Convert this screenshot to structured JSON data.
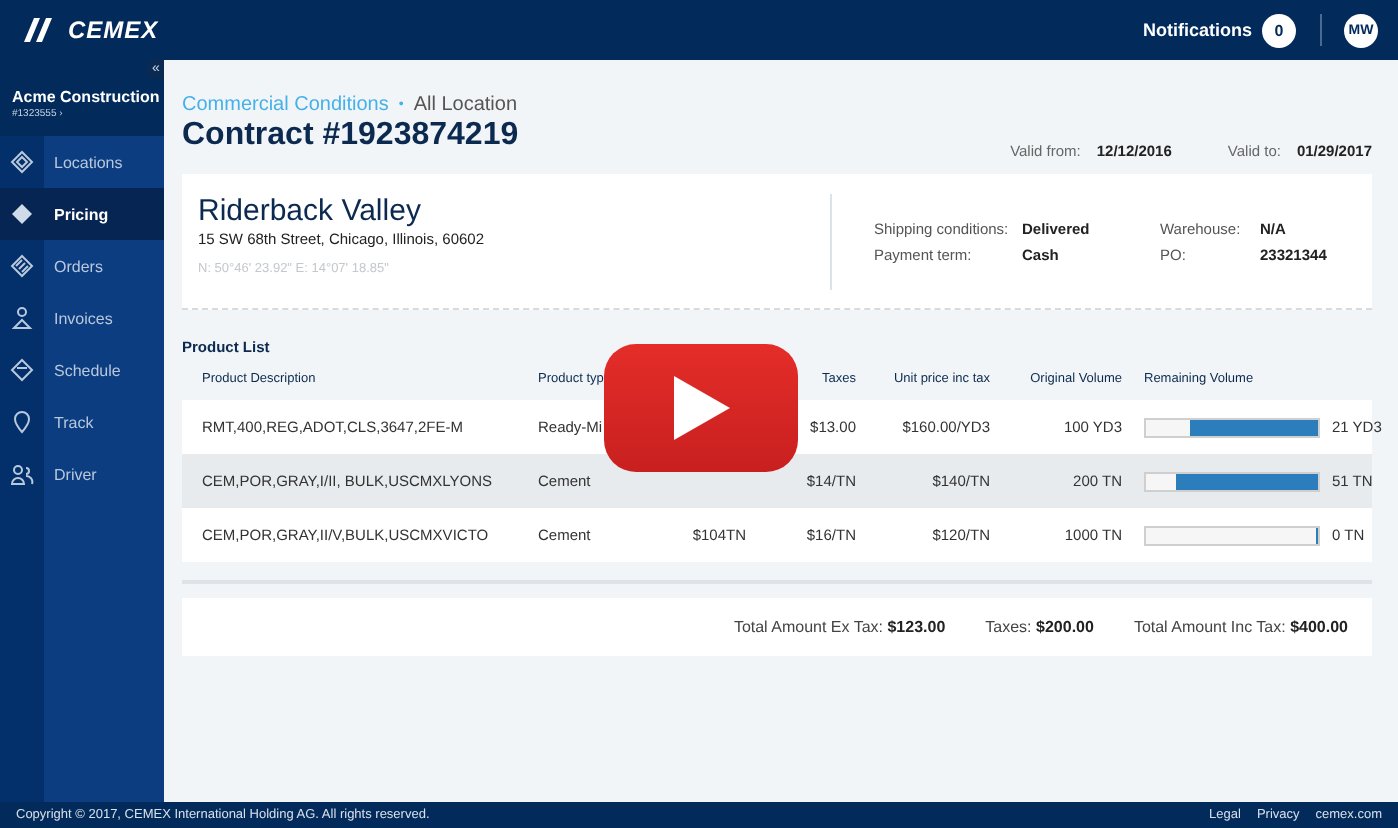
{
  "header": {
    "logo": "CEMEX",
    "notifications_label": "Notifications",
    "notifications_count": "0",
    "avatar": "MW"
  },
  "sidebar": {
    "collapse": "«",
    "company": "Acme Construction",
    "account": "#1323555 ›",
    "items": [
      {
        "label": "Locations",
        "selected": false
      },
      {
        "label": "Pricing",
        "selected": true
      },
      {
        "label": "Orders",
        "selected": false
      },
      {
        "label": "Invoices",
        "selected": false
      },
      {
        "label": "Schedule",
        "selected": false
      },
      {
        "label": "Track",
        "selected": false
      },
      {
        "label": "Driver",
        "selected": false
      }
    ]
  },
  "breadcrumb": {
    "link": "Commercial Conditions",
    "separator": "•",
    "current": "All Location"
  },
  "title": "Contract #1923874219",
  "validity": [
    {
      "label": "Valid from:",
      "value": "12/12/2016"
    },
    {
      "label": "Valid to:",
      "value": "01/29/2017"
    }
  ],
  "location": {
    "name": "Riderback Valley",
    "address": "15 SW 68th Street, Chicago, Illinois, 60602",
    "coordinates": "N: 50°46' 23.92\" E: 14°07' 18.85\""
  },
  "terms": [
    {
      "label": "Shipping conditions:",
      "value": "Delivered"
    },
    {
      "label": "Warehouse:",
      "value": "N/A"
    },
    {
      "label": "Payment term:",
      "value": "Cash"
    },
    {
      "label": "PO:",
      "value": "23321344"
    }
  ],
  "product_list": {
    "title": "Product List",
    "columns": [
      {
        "label": "Product Description"
      },
      {
        "label": "Product typ"
      },
      {},
      {
        "label": "Taxes"
      },
      {
        "label": "Unit price inc tax"
      },
      {
        "label": "Original Volume"
      },
      {
        "label": "Remaining Volume"
      }
    ],
    "rows": [
      {
        "description": "RMT,400,REG,ADOT,CLS,3647,2FE-M",
        "type": "Ready-Mi",
        "taxes": "$13.00",
        "unit_price": "$160.00/YD3",
        "original": "100 YD3",
        "level": 0.75,
        "remaining": "21 YD3"
      },
      {
        "description": "CEM,POR,GRAY,I/II, BULK,USCMXLYONS",
        "type": "Cement",
        "taxes": "$14/TN",
        "unit_price": "$140/TN",
        "original": "200 TN",
        "level": 0.83,
        "remaining": "51 TN"
      },
      {
        "description": "CEM,POR,GRAY,II/V,BULK,USCMXVICTO",
        "type": "Cement",
        "price": "$104TN",
        "taxes": "$16/TN",
        "unit_price": "$120/TN",
        "original": "1000 TN",
        "level": 0,
        "remaining": "0 TN"
      }
    ]
  },
  "totals": [
    {
      "label": "Total Amount Ex Tax:",
      "value": "$123.00"
    },
    {
      "label": "Taxes:",
      "value": "$200.00"
    },
    {
      "label": "Total Amount Inc Tax:",
      "value": "$400.00"
    }
  ],
  "footer": {
    "copyright": "Copyright © 2017, CEMEX International Holding AG. All rights reserved.",
    "links": [
      "Legal",
      "Privacy",
      "cemex.com"
    ]
  },
  "video": {
    "kind": "play_overlay"
  }
}
